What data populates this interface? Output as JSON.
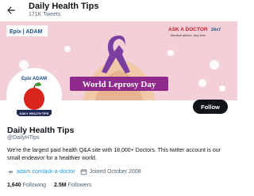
{
  "header": {
    "title": "Daily Health Tips",
    "tweet_count": "171K Tweets",
    "back_icon": "arrow-left-icon"
  },
  "banner": {
    "left_logo": "Epix | ADAM",
    "right_logo_main": "ASK A DOCTOR",
    "right_logo_suffix": "24x7",
    "right_logo_tagline": "Medical advice, Any time",
    "caption": "World Leprosy Day",
    "ribbon_color": "#7b3fa0"
  },
  "profile": {
    "avatar_top": "Epix ADAM",
    "avatar_banner": "DAILY HEALTH TIPS",
    "name": "Daily Health Tips",
    "handle": "@DailyHTips",
    "bio": "We're the largest paid health Q&A site with 18,000+ Doctors. This twitter account is our small endeavor for a healthier world.",
    "website": "adam.com/ask-a-doctor",
    "joined": "Joined October 2008",
    "following_count": "1,640",
    "following_label": "Following",
    "followers_count": "2.5M",
    "followers_label": "Followers",
    "follow_button": "Follow"
  }
}
